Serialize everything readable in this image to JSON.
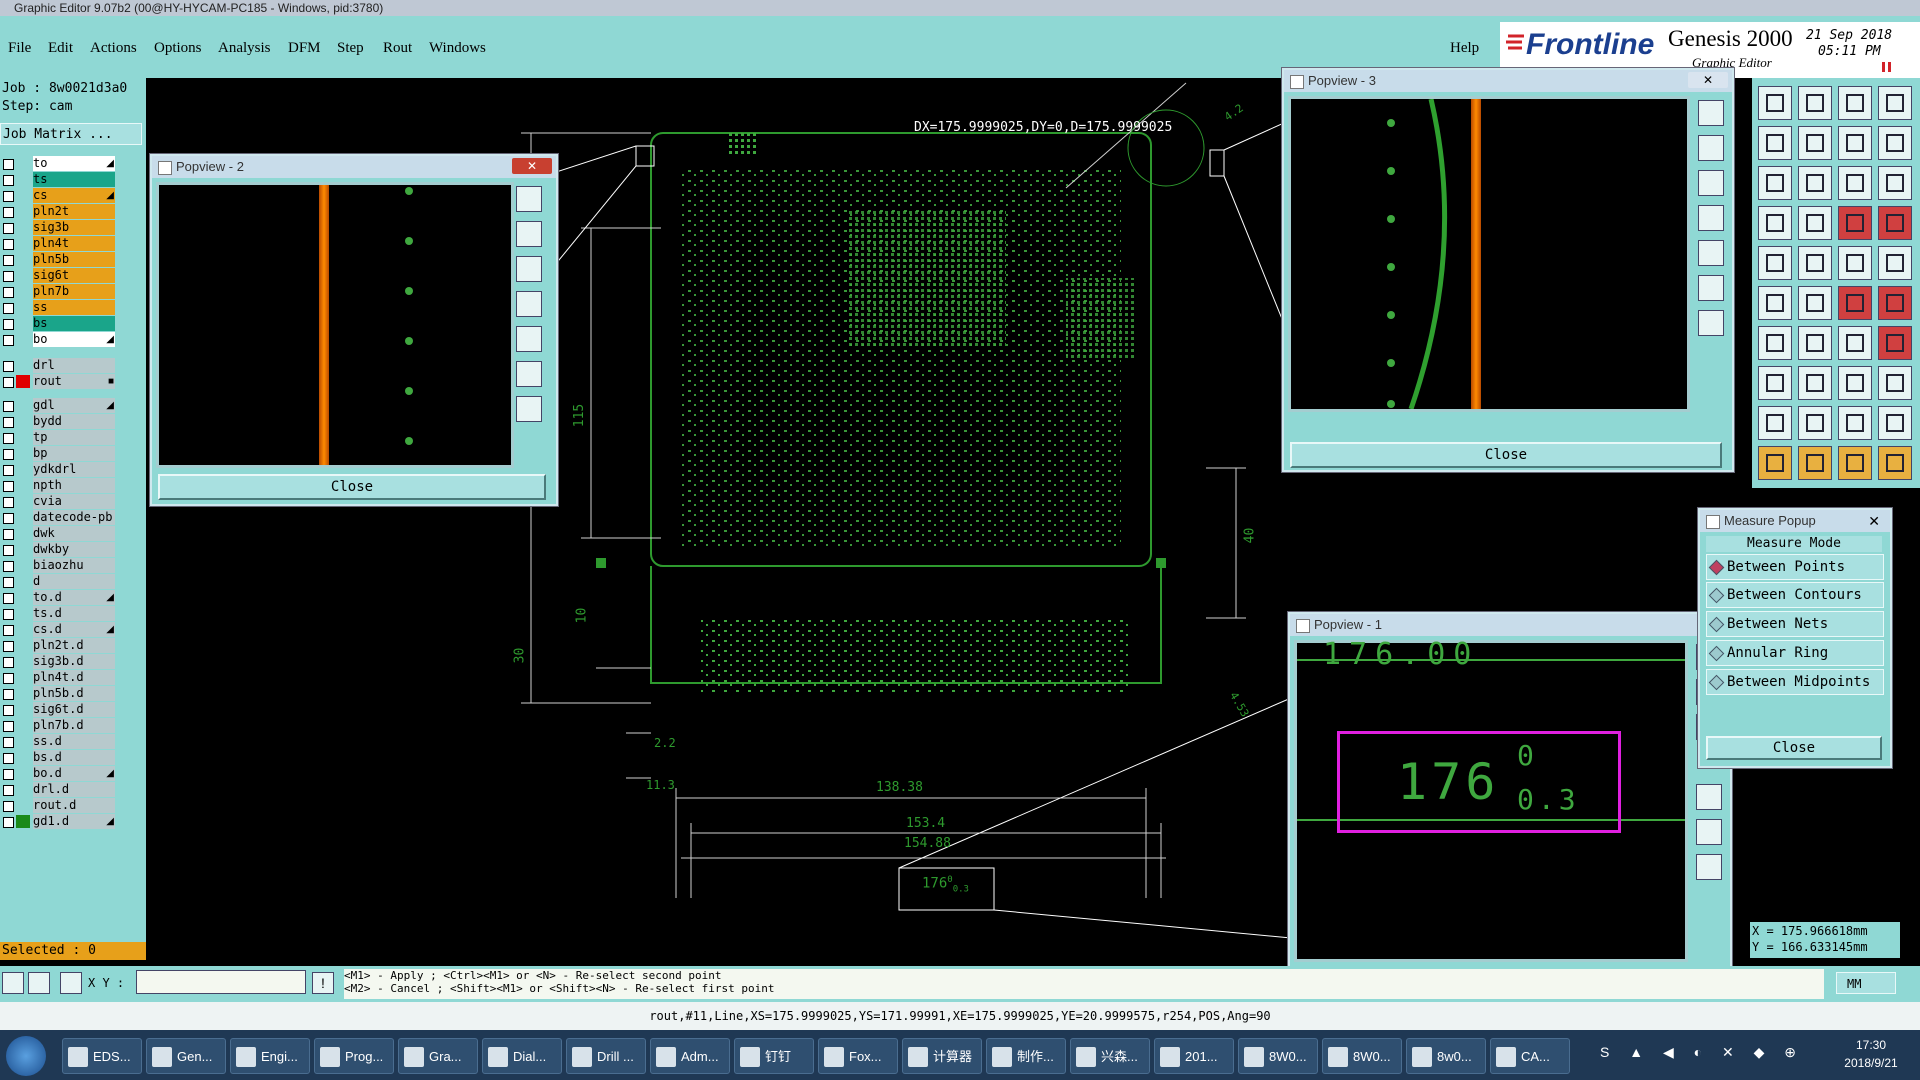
{
  "window": {
    "title": "Graphic Editor 9.07b2 (00@HY-HYCAM-PC185 - Windows, pid:3780)"
  },
  "menu": [
    "File",
    "Edit",
    "Actions",
    "Options",
    "Analysis",
    "DFM",
    "Step",
    "Rout",
    "Windows"
  ],
  "help_label": "Help",
  "brand": {
    "logo": "Frontline",
    "product": "Genesis 2000",
    "subtitle": "Graphic Editor",
    "date": "21 Sep 2018",
    "time": "05:11 PM"
  },
  "job": {
    "job_line": "Job : 8w0021d3a0",
    "step_line": "Step: cam",
    "matrix_label": "Job Matrix ..."
  },
  "layers": [
    {
      "name": "to",
      "color": "#ffffff",
      "mark": "arrow"
    },
    {
      "name": "ts",
      "color": "#1aa58a",
      "mark": ""
    },
    {
      "name": "cs",
      "color": "#e7a01a",
      "mark": "arrow"
    },
    {
      "name": "pln2t",
      "color": "#e7a01a",
      "mark": ""
    },
    {
      "name": "sig3b",
      "color": "#e7a01a",
      "mark": ""
    },
    {
      "name": "pln4t",
      "color": "#e7a01a",
      "mark": ""
    },
    {
      "name": "pln5b",
      "color": "#e7a01a",
      "mark": ""
    },
    {
      "name": "sig6t",
      "color": "#e7a01a",
      "mark": ""
    },
    {
      "name": "pln7b",
      "color": "#e7a01a",
      "mark": ""
    },
    {
      "name": "ss",
      "color": "#e7a01a",
      "mark": ""
    },
    {
      "name": "bs",
      "color": "#1aa58a",
      "mark": ""
    },
    {
      "name": "bo",
      "color": "#ffffff",
      "mark": "arrow"
    },
    {
      "name": "drl",
      "color": "#b7c9cc",
      "mark": ""
    },
    {
      "name": "rout",
      "color": "#b7c9cc",
      "mark": "square"
    },
    {
      "name": "gdl",
      "color": "#b7c9cc",
      "mark": "arrow"
    },
    {
      "name": "bydd",
      "color": "#b7c9cc",
      "mark": ""
    },
    {
      "name": "tp",
      "color": "#b7c9cc",
      "mark": ""
    },
    {
      "name": "bp",
      "color": "#b7c9cc",
      "mark": ""
    },
    {
      "name": "ydkdrl",
      "color": "#b7c9cc",
      "mark": ""
    },
    {
      "name": "npth",
      "color": "#b7c9cc",
      "mark": ""
    },
    {
      "name": "cvia",
      "color": "#b7c9cc",
      "mark": ""
    },
    {
      "name": "datecode-pb",
      "color": "#b7c9cc",
      "mark": ""
    },
    {
      "name": "dwk",
      "color": "#b7c9cc",
      "mark": ""
    },
    {
      "name": "dwkby",
      "color": "#b7c9cc",
      "mark": ""
    },
    {
      "name": "biaozhu",
      "color": "#b7c9cc",
      "mark": ""
    },
    {
      "name": "d",
      "color": "#b7c9cc",
      "mark": ""
    },
    {
      "name": "to.d",
      "color": "#b7c9cc",
      "mark": "arrow"
    },
    {
      "name": "ts.d",
      "color": "#b7c9cc",
      "mark": ""
    },
    {
      "name": "cs.d",
      "color": "#b7c9cc",
      "mark": "arrow"
    },
    {
      "name": "pln2t.d",
      "color": "#b7c9cc",
      "mark": ""
    },
    {
      "name": "sig3b.d",
      "color": "#b7c9cc",
      "mark": ""
    },
    {
      "name": "pln4t.d",
      "color": "#b7c9cc",
      "mark": ""
    },
    {
      "name": "pln5b.d",
      "color": "#b7c9cc",
      "mark": ""
    },
    {
      "name": "sig6t.d",
      "color": "#b7c9cc",
      "mark": ""
    },
    {
      "name": "pln7b.d",
      "color": "#b7c9cc",
      "mark": ""
    },
    {
      "name": "ss.d",
      "color": "#b7c9cc",
      "mark": ""
    },
    {
      "name": "bs.d",
      "color": "#b7c9cc",
      "mark": ""
    },
    {
      "name": "bo.d",
      "color": "#b7c9cc",
      "mark": "arrow"
    },
    {
      "name": "drl.d",
      "color": "#b7c9cc",
      "mark": ""
    },
    {
      "name": "rout.d",
      "color": "#b7c9cc",
      "mark": ""
    },
    {
      "name": "gd1.d",
      "color": "#b7c9cc",
      "mark": "arrow"
    }
  ],
  "selected_label": "Selected : 0",
  "canvas": {
    "measure_readout": "DX=175.9999025,DY=0,D=175.9999025",
    "dims": [
      "138.38",
      "153.4",
      "154.88",
      "115",
      "40",
      "30",
      "10",
      "2.2",
      "11.3",
      "4.53",
      "4.2"
    ],
    "zoom_label": "176",
    "zoom_sup": "0",
    "zoom_sub": "0.3"
  },
  "popviews": {
    "p1_title": "Popview - 1",
    "p2_title": "Popview - 2",
    "p3_title": "Popview - 3",
    "close": "Close",
    "p1_main": "176",
    "p1_sup": "0",
    "p1_sub": "0.3",
    "p1_top": "176.00"
  },
  "measure_popup": {
    "title": "Measure Popup",
    "heading": "Measure Mode",
    "options": [
      "Between Points",
      "Between Contours",
      "Between Nets",
      "Annular Ring",
      "Between Midpoints"
    ],
    "selected": "Between Points",
    "close": "Close"
  },
  "coords": {
    "x": "X = 175.966618mm",
    "y": "Y = 166.633145mm"
  },
  "xy_label": "X Y :",
  "hints": [
    "<M1> - Apply  ; <Ctrl><M1> or <N> - Re-select second point",
    "<M2> - Cancel ; <Shift><M1> or <Shift><N> - Re-select first point"
  ],
  "units": "MM",
  "status": "rout,#11,Line,XS=175.9999025,YS=171.99991,XE=175.9999025,YE=20.9999575,r254,POS,Ang=90",
  "taskbar": {
    "items": [
      "EDS...",
      "Gen...",
      "Engi...",
      "Prog...",
      "Gra...",
      "Dial...",
      "Drill ...",
      "Adm...",
      "钉钉",
      "Fox...",
      "计算器",
      "制作...",
      "兴森...",
      "201...",
      "8W0...",
      "8W0...",
      "8w0...",
      "CA..."
    ],
    "time": "17:30",
    "date": "2018/9/21"
  }
}
